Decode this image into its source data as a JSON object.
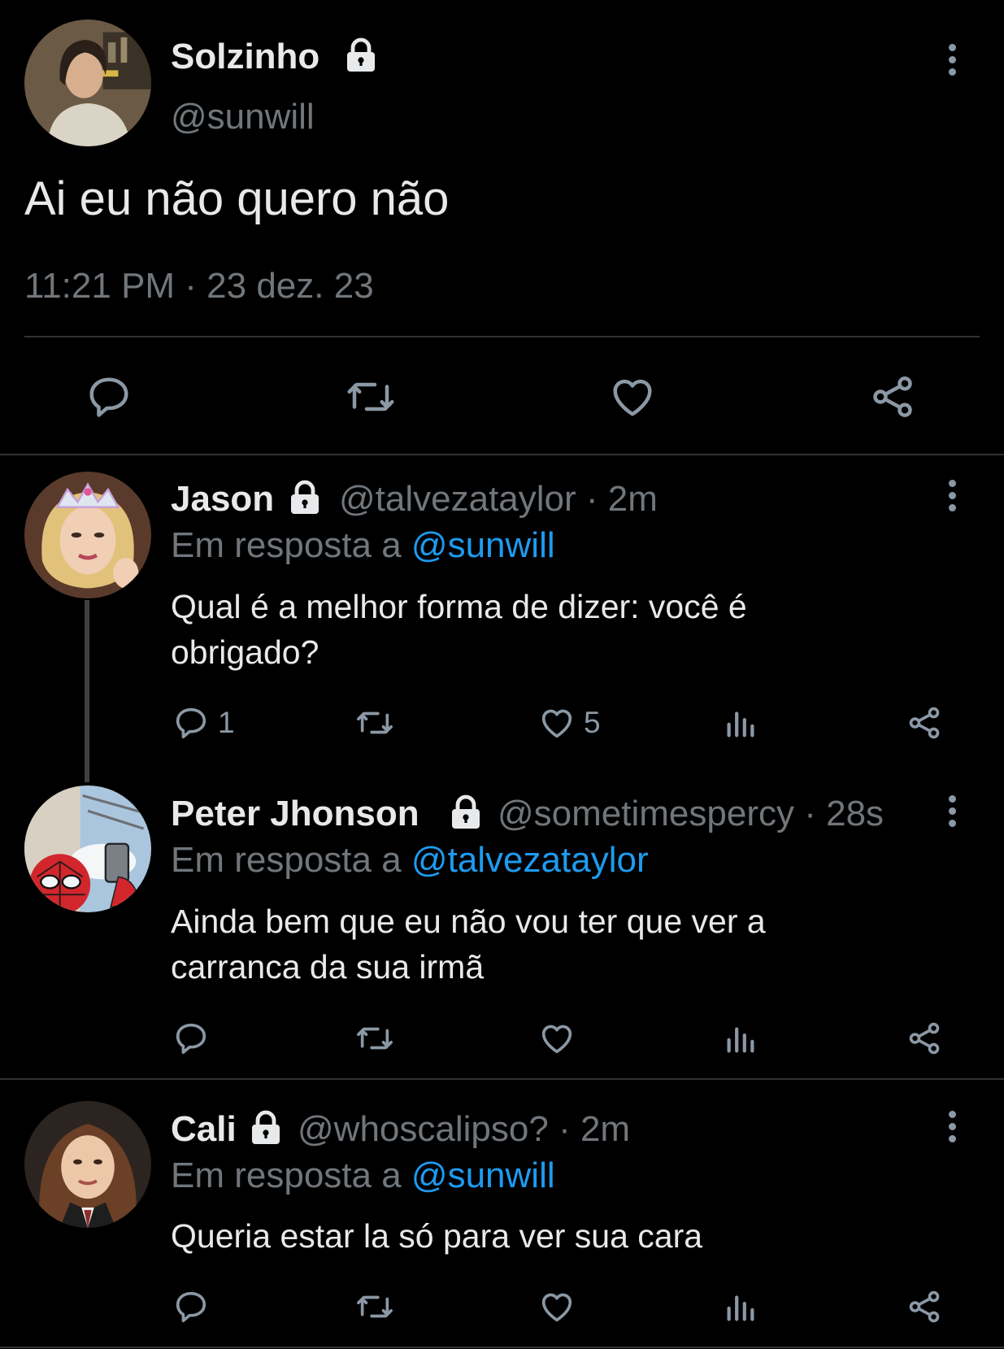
{
  "main_tweet": {
    "name": "Solzinho",
    "handle": "@sunwill",
    "text": "Ai eu não quero não",
    "timestamp": "11:21 PM · 23 dez. 23",
    "icons": {
      "reply": "reply-icon",
      "retweet": "retweet-icon",
      "like": "heart-icon",
      "share": "share-icon"
    }
  },
  "replies": [
    {
      "name": "Jason",
      "handle": "@talvezataylor",
      "time": "· 2m",
      "reply_prefix": "Em resposta a",
      "reply_to": "@sunwill",
      "text_line1": "Qual é a melhor forma de dizer: você é",
      "text_line2": "obrigado?",
      "reply_count": "1",
      "like_count": "5"
    },
    {
      "name": "Peter Jhonson",
      "handle": "@sometimespercy",
      "time": "· 28s",
      "reply_prefix": "Em resposta a",
      "reply_to": "@talvezataylor",
      "text_line1": "Ainda bem que eu não vou ter que ver a",
      "text_line2": "carranca da sua irmã"
    },
    {
      "name": "Cali",
      "handle": "@whoscalipso?",
      "time": "· 2m",
      "reply_prefix": "Em resposta a",
      "reply_to": "@sunwill",
      "text_line1": "Queria estar la só para ver sua cara"
    }
  ],
  "colors": {
    "background": "#000000",
    "text": "#e7e9ea",
    "muted": "#71767b",
    "link": "#1d9bf0",
    "divider": "#2f3336"
  }
}
